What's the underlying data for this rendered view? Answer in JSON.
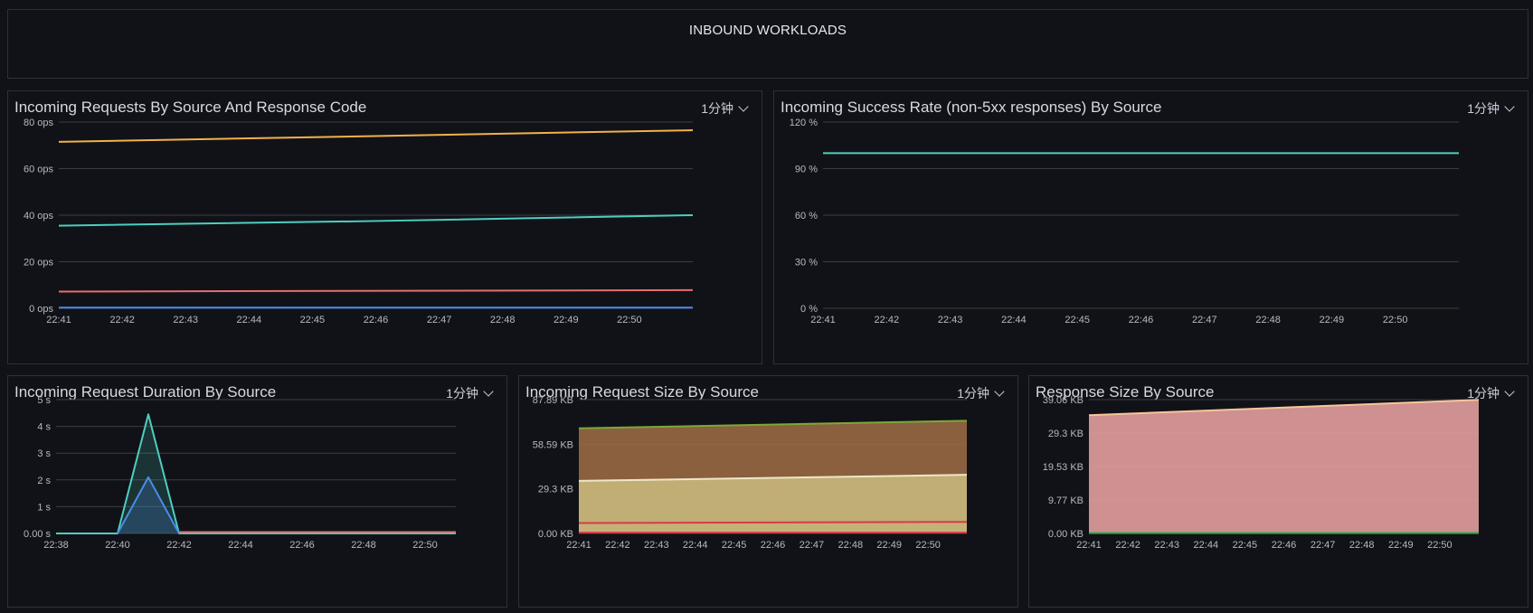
{
  "banner": {
    "title": "INBOUND WORKLOADS"
  },
  "panels": [
    {
      "title": "Incoming Requests By Source And Response Code",
      "interval": "1分钟",
      "chart_data": {
        "type": "line",
        "x": [
          "22:41",
          "22:42",
          "22:43",
          "22:44",
          "22:45",
          "22:46",
          "22:47",
          "22:48",
          "22:49",
          "22:50"
        ],
        "x_range": [
          0,
          10
        ],
        "ylim": [
          0,
          80
        ],
        "yticks": [
          "0 ops",
          "20 ops",
          "40 ops",
          "60 ops",
          "80 ops"
        ],
        "ytick_values": [
          0,
          20,
          40,
          60,
          80
        ],
        "grid": true,
        "series": [
          {
            "color": "#f2b14a",
            "points": [
              [
                0,
                71.5
              ],
              [
                10,
                76.5
              ]
            ]
          },
          {
            "color": "#4ccfc0",
            "points": [
              [
                0,
                35.5
              ],
              [
                5,
                37.5
              ],
              [
                10,
                40
              ]
            ]
          },
          {
            "color": "#e46f6f",
            "points": [
              [
                0,
                7.2
              ],
              [
                10,
                7.8
              ]
            ]
          },
          {
            "color": "#4a8ce8",
            "points": [
              [
                0,
                0.3
              ],
              [
                10,
                0.3
              ]
            ]
          }
        ]
      }
    },
    {
      "title": "Incoming Success Rate (non-5xx responses) By Source",
      "interval": "1分钟",
      "chart_data": {
        "type": "line",
        "x": [
          "22:41",
          "22:42",
          "22:43",
          "22:44",
          "22:45",
          "22:46",
          "22:47",
          "22:48",
          "22:49",
          "22:50"
        ],
        "x_range": [
          0,
          10
        ],
        "ylim": [
          0,
          120
        ],
        "yticks": [
          "0 %",
          "30 %",
          "60 %",
          "90 %",
          "120 %"
        ],
        "ytick_values": [
          0,
          30,
          60,
          90,
          120
        ],
        "grid": true,
        "series": [
          {
            "color": "#4ccfc0",
            "points": [
              [
                0,
                100
              ],
              [
                10,
                100
              ]
            ]
          }
        ]
      }
    },
    {
      "title": "Incoming Request Duration By Source",
      "interval": "1分钟",
      "chart_data": {
        "type": "area",
        "x": [
          "22:38",
          "22:40",
          "22:42",
          "22:44",
          "22:46",
          "22:48",
          "22:50"
        ],
        "x_range": [
          0,
          13
        ],
        "ylim": [
          0,
          5
        ],
        "yticks": [
          "0.00 s",
          "1 s",
          "2 s",
          "3 s",
          "4 s",
          "5 s"
        ],
        "ytick_values": [
          0,
          1,
          2,
          3,
          4,
          5
        ],
        "grid": true,
        "series": [
          {
            "color": "#4ccfc0",
            "fill": "rgba(76,207,192,0.18)",
            "points": [
              [
                0,
                0
              ],
              [
                2,
                0
              ],
              [
                3,
                4.45
              ],
              [
                4,
                0
              ],
              [
                13,
                0
              ]
            ]
          },
          {
            "color": "#4a8ce8",
            "fill": "rgba(74,140,232,0.22)",
            "points": [
              [
                2,
                0
              ],
              [
                3,
                2.1
              ],
              [
                4,
                0
              ]
            ]
          },
          {
            "color": "#e46f6f",
            "points": [
              [
                4,
                0.05
              ],
              [
                13,
                0.05
              ]
            ]
          }
        ]
      }
    },
    {
      "title": "Incoming Request Size By Source",
      "interval": "1分钟",
      "chart_data": {
        "type": "area",
        "x": [
          "22:41",
          "22:42",
          "22:43",
          "22:44",
          "22:45",
          "22:46",
          "22:47",
          "22:48",
          "22:49",
          "22:50"
        ],
        "x_range": [
          0,
          10
        ],
        "ylim": [
          0,
          87.89
        ],
        "yticks": [
          "0.00 KB",
          "29.3 KB",
          "58.59 KB",
          "87.89 KB"
        ],
        "ytick_values": [
          0,
          29.3,
          58.59,
          87.89
        ],
        "grid": true,
        "series": [
          {
            "color": "#7ba837",
            "fill": "rgba(160,110,70,0.85)",
            "points": [
              [
                0,
                69
              ],
              [
                10,
                74
              ]
            ]
          },
          {
            "color": "#f0e6c8",
            "fill": "rgba(196,178,120,0.95)",
            "points": [
              [
                0,
                34.5
              ],
              [
                10,
                38.5
              ]
            ]
          },
          {
            "color": "#d83a4a",
            "fill": "rgba(196,178,120,0.95)",
            "points": [
              [
                0,
                6.8
              ],
              [
                10,
                7.6
              ]
            ]
          },
          {
            "color": "#d83a4a",
            "points": [
              [
                0,
                0.5
              ],
              [
                10,
                0.5
              ]
            ]
          }
        ]
      }
    },
    {
      "title": "Response Size By Source",
      "interval": "1分钟",
      "chart_data": {
        "type": "area",
        "x": [
          "22:41",
          "22:42",
          "22:43",
          "22:44",
          "22:45",
          "22:46",
          "22:47",
          "22:48",
          "22:49",
          "22:50"
        ],
        "x_range": [
          0,
          10
        ],
        "ylim": [
          0,
          39.06
        ],
        "yticks": [
          "0.00 KB",
          "9.77 KB",
          "19.53 KB",
          "29.3 KB",
          "39.06 KB"
        ],
        "ytick_values": [
          0,
          9.77,
          19.53,
          29.3,
          39.06
        ],
        "grid": true,
        "series": [
          {
            "color": "#f7c59a",
            "fill": "rgba(222,155,155,0.92)",
            "points": [
              [
                0,
                34.5
              ],
              [
                10,
                39
              ]
            ]
          },
          {
            "color": "#2fa84a",
            "points": [
              [
                0,
                0.1
              ],
              [
                10,
                0.1
              ]
            ]
          }
        ]
      }
    }
  ]
}
